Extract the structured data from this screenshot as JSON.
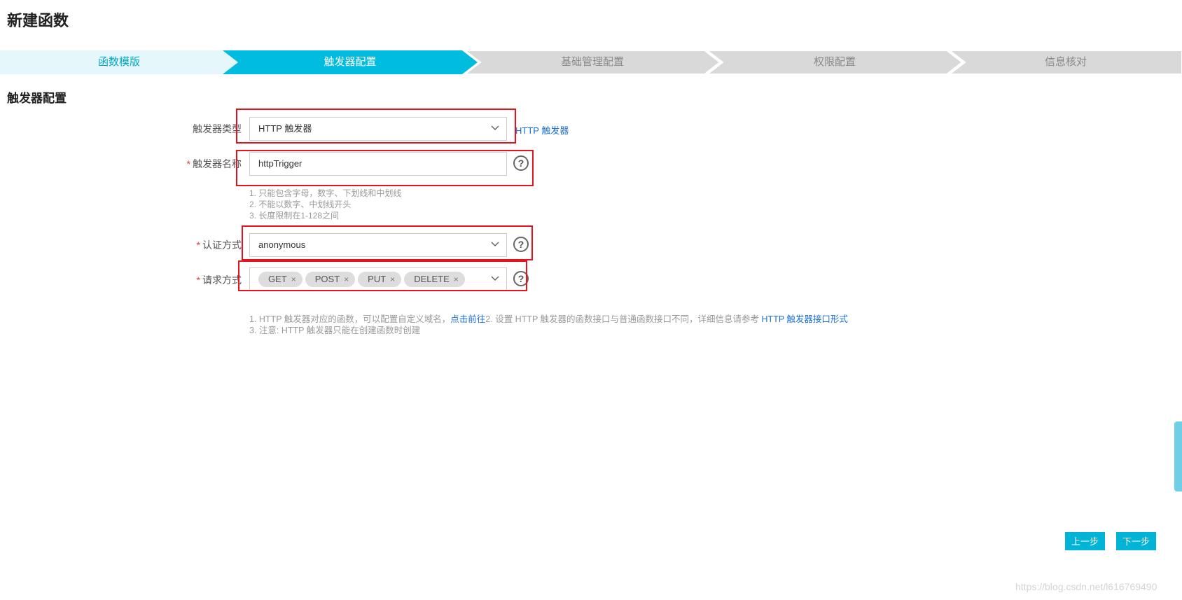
{
  "page_title": "新建函数",
  "steps": [
    {
      "label": "函数模版",
      "state": "done"
    },
    {
      "label": "触发器配置",
      "state": "active"
    },
    {
      "label": "基础管理配置",
      "state": "todo"
    },
    {
      "label": "权限配置",
      "state": "todo"
    },
    {
      "label": "信息核对",
      "state": "todo"
    }
  ],
  "section_title": "触发器配置",
  "form": {
    "trigger_type": {
      "label": "触发器类型",
      "value": "HTTP 触发器",
      "link": "HTTP 触发器"
    },
    "trigger_name": {
      "required": "*",
      "label": "触发器名称",
      "value": "httpTrigger",
      "hints": [
        "1. 只能包含字母，数字、下划线和中划线",
        "2. 不能以数字、中划线开头",
        "3. 长度限制在1-128之间"
      ]
    },
    "auth": {
      "required": "*",
      "label": "认证方式",
      "value": "anonymous"
    },
    "methods": {
      "required": "*",
      "label": "请求方式",
      "tags": [
        "GET",
        "POST",
        "PUT",
        "DELETE"
      ],
      "remove_glyph": "×"
    },
    "notes": {
      "line1_a": "1. HTTP 触发器对应的函数，可以配置自定义域名，",
      "line1_link1": "点击前往",
      "line1_b": "2. 设置 HTTP 触发器的函数接口与普通函数接口不同，详细信息请参考 ",
      "line1_link2": "HTTP 触发器接口形式",
      "line2": "3. 注意: HTTP 触发器只能在创建函数时创建"
    }
  },
  "buttons": {
    "prev": "上一步",
    "next": "下一步"
  },
  "watermark": "https://blog.csdn.net/l616769490",
  "colors": {
    "accent": "#00b4d8",
    "active_step": "#00bde0",
    "done_step": "#e6f7fb",
    "todo_step": "#d9d9d9",
    "highlight": "#e8121f",
    "link": "#1a6fd0"
  }
}
